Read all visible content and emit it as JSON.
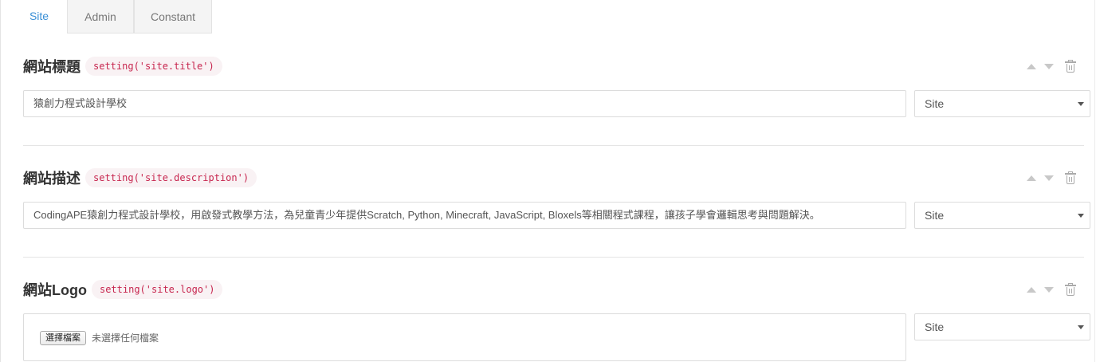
{
  "tabs": [
    {
      "label": "Site",
      "active": true
    },
    {
      "label": "Admin",
      "active": false
    },
    {
      "label": "Constant",
      "active": false
    }
  ],
  "settings": [
    {
      "title": "網站標題",
      "key_code": "setting('site.title')",
      "value": "猿創力程式設計學校",
      "group": "Site"
    },
    {
      "title": "網站描述",
      "key_code": "setting('site.description')",
      "value": "CodingAPE猿創力程式設計學校，用啟發式教學方法，為兒童青少年提供Scratch, Python, Minecraft, JavaScript, Bloxels等相關程式課程，讓孩子學會邏輯思考與問題解決。",
      "group": "Site"
    },
    {
      "title": "網站Logo",
      "key_code": "setting('site.logo')",
      "file_button": "選擇檔案",
      "file_status": "未選擇任何檔案",
      "group": "Site"
    }
  ],
  "colors": {
    "accent": "#3a8fd6",
    "code_text": "#c7254e",
    "code_bg": "#f9f2f4"
  },
  "icons": [
    "arrow-up-icon",
    "arrow-down-icon",
    "trash-icon",
    "caret-down-icon"
  ]
}
